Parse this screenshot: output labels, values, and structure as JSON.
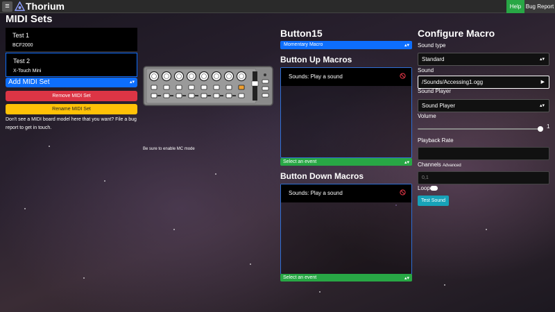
{
  "app": {
    "brand": "Thorium",
    "menu_icon": "hamburger-icon",
    "logo_icon": "thorium-logo-icon"
  },
  "topbar": {
    "help_label": "Help",
    "bug_label": "Bug Report"
  },
  "midi_sets": {
    "title": "MIDI Sets",
    "items": [
      {
        "name": "Test 1",
        "model": "BCF2000"
      },
      {
        "name": "Test 2",
        "model": "X-Touch Mini"
      }
    ],
    "add_label": "Add MIDI Set",
    "remove_label": "Remove MIDI Set",
    "rename_label": "Rename MIDI Set",
    "note": "Don't see a MIDI board model here that you want? File a bug report to get in touch."
  },
  "board": {
    "mc_note": "Be sure to enable MC mode",
    "highlight_color": "#f0a030"
  },
  "button": {
    "title": "Button15",
    "mode": "Momentary Macro",
    "up_title": "Button Up Macros",
    "up_item": "Sounds: Play a sound",
    "down_title": "Button Down Macros",
    "down_item": "Sounds: Play a sound",
    "event_placeholder": "Select an event"
  },
  "config": {
    "title": "Configure Macro",
    "sound_type_label": "Sound type",
    "sound_type": "Standard",
    "sound_label": "Sound",
    "sound": "/Sounds/Accessing1.ogg",
    "player_label": "Sound Player",
    "player": "Sound Player",
    "volume_label": "Volume",
    "volume": "1",
    "playback_label": "Playback Rate",
    "playback": "",
    "channels_label": "Channels",
    "channels_advanced": "Advanced",
    "channels_placeholder": "0,1",
    "loop_label": "Loop",
    "test_label": "Test Sound"
  },
  "colors": {
    "primary": "#0d6efd",
    "danger": "#dc3545",
    "warning": "#ffc107",
    "success": "#28a745",
    "info": "#17a2b8"
  }
}
